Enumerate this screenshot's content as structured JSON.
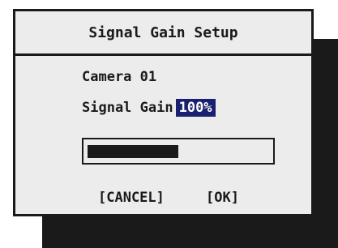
{
  "dialog": {
    "title": "Signal Gain Setup",
    "camera_label": "Camera 01",
    "signal_gain_label": "Signal Gain",
    "signal_gain_value": "100%",
    "progress_fraction": 0.5
  },
  "buttons": {
    "cancel_label": "[CANCEL]",
    "ok_label": "[OK]"
  },
  "colors": {
    "dialog_background": "#ececec",
    "border": "#1a1a1a",
    "highlight_background": "#1a2070",
    "highlight_text": "#ffffff",
    "shadow": "#1a1a1a"
  }
}
